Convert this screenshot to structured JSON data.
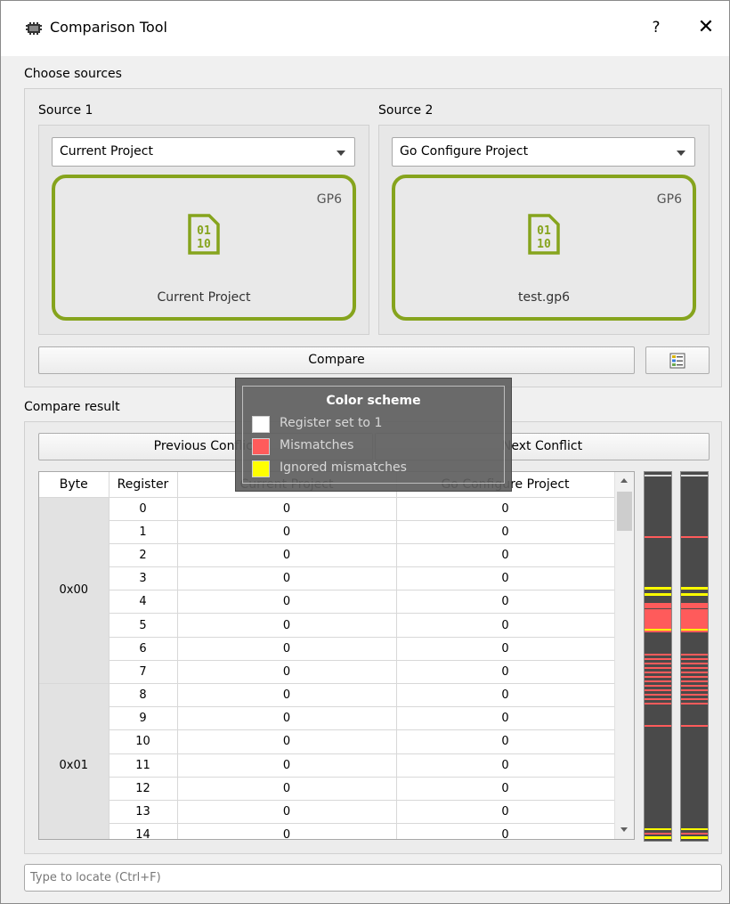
{
  "window": {
    "title": "Comparison Tool",
    "help": "?",
    "close": "✕"
  },
  "sources": {
    "section_title": "Choose sources",
    "source1": {
      "label": "Source 1",
      "selected": "Current Project",
      "badge": "GP6",
      "caption": "Current Project",
      "icon": "binary-file-icon"
    },
    "source2": {
      "label": "Source 2",
      "selected": "Go Configure Project",
      "badge": "GP6",
      "caption": "test.gp6",
      "icon": "binary-file-icon"
    },
    "compare_label": "Compare",
    "color_scheme_button_icon": "legend-icon"
  },
  "result": {
    "section_title": "Compare result",
    "prev_label": "Previous Conflict",
    "next_label": "Next Conflict",
    "columns": [
      "Byte",
      "Register",
      "Current Project",
      "Go Configure Project"
    ],
    "groups": [
      {
        "byte": "0x00",
        "rows": [
          {
            "register": "0",
            "current": "0",
            "other": "0"
          },
          {
            "register": "1",
            "current": "0",
            "other": "0"
          },
          {
            "register": "2",
            "current": "0",
            "other": "0"
          },
          {
            "register": "3",
            "current": "0",
            "other": "0"
          },
          {
            "register": "4",
            "current": "0",
            "other": "0"
          },
          {
            "register": "5",
            "current": "0",
            "other": "0"
          },
          {
            "register": "6",
            "current": "0",
            "other": "0"
          },
          {
            "register": "7",
            "current": "0",
            "other": "0"
          }
        ]
      },
      {
        "byte": "0x01",
        "rows": [
          {
            "register": "8",
            "current": "0",
            "other": "0"
          },
          {
            "register": "9",
            "current": "0",
            "other": "0"
          },
          {
            "register": "10",
            "current": "0",
            "other": "0"
          },
          {
            "register": "11",
            "current": "0",
            "other": "0"
          },
          {
            "register": "12",
            "current": "0",
            "other": "0"
          },
          {
            "register": "13",
            "current": "0",
            "other": "0"
          },
          {
            "register": "14",
            "current": "0",
            "other": "0"
          }
        ]
      }
    ]
  },
  "tooltip": {
    "title": "Color scheme",
    "items": [
      {
        "label": "Register set to 1",
        "color": "#ffffff"
      },
      {
        "label": "Mismatches",
        "color": "#ff5b5b"
      },
      {
        "label": "Ignored mismatches",
        "color": "#ffff00"
      }
    ]
  },
  "search": {
    "placeholder": "Type to locate (Ctrl+F)",
    "value": ""
  },
  "colors": {
    "accent_green": "#86a41d",
    "mismatch": "#ff5b5b",
    "ignored": "#ffff00",
    "overview_bg": "#4a4a4a"
  }
}
